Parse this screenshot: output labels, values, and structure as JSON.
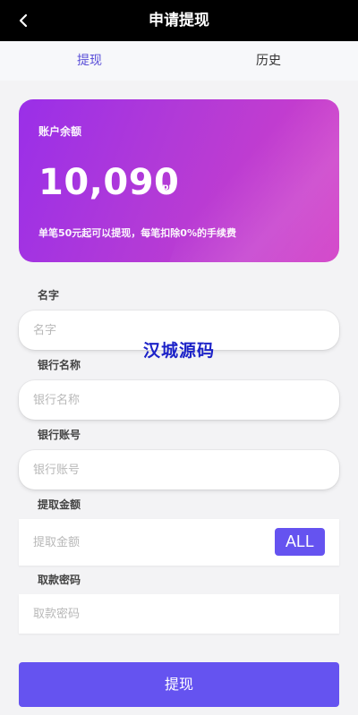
{
  "header": {
    "title": "申请提现",
    "back_icon": "chevron-left-icon"
  },
  "tabs": [
    {
      "label": "提现",
      "active": true
    },
    {
      "label": "历史",
      "active": false
    }
  ],
  "balance_card": {
    "label": "账户余额",
    "amount": "10,090",
    "unit": "грн",
    "note": "单笔50元起可以提现，每笔扣除0%的手续费"
  },
  "form": {
    "name": {
      "label": "名字",
      "placeholder": "名字",
      "value": ""
    },
    "bank_name": {
      "label": "银行名称",
      "placeholder": "银行名称",
      "value": ""
    },
    "bank_account": {
      "label": "银行账号",
      "placeholder": "银行账号",
      "value": ""
    },
    "amount": {
      "label": "提取金额",
      "placeholder": "提取金额",
      "value": "",
      "all_label": "ALL"
    },
    "password": {
      "label": "取款密码",
      "placeholder": "取款密码",
      "value": ""
    }
  },
  "watermark": "汉城源码",
  "submit_label": "提现",
  "colors": {
    "accent": "#6553f0",
    "header_bg": "#000000",
    "card_start": "#9a2fe8",
    "card_end": "#d23fc7"
  }
}
